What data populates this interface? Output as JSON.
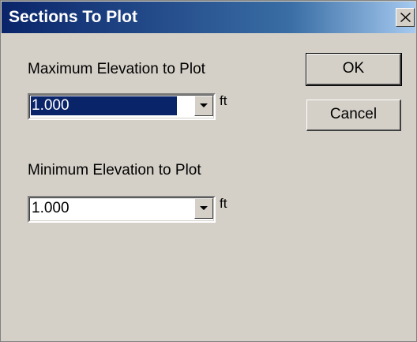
{
  "window": {
    "title": "Sections To Plot"
  },
  "max_elevation": {
    "label": "Maximum Elevation to Plot",
    "value": "1.000",
    "unit": "ft"
  },
  "min_elevation": {
    "label": "Minimum Elevation to Plot",
    "value": "1.000",
    "unit": "ft"
  },
  "buttons": {
    "ok": "OK",
    "cancel": "Cancel"
  },
  "icons": {
    "close": "close-icon",
    "dropdown": "chevron-down-icon"
  },
  "colors": {
    "titlebar": "#0a246a",
    "selection": "#0a246a",
    "dialog_bg": "#d4d0c8"
  }
}
